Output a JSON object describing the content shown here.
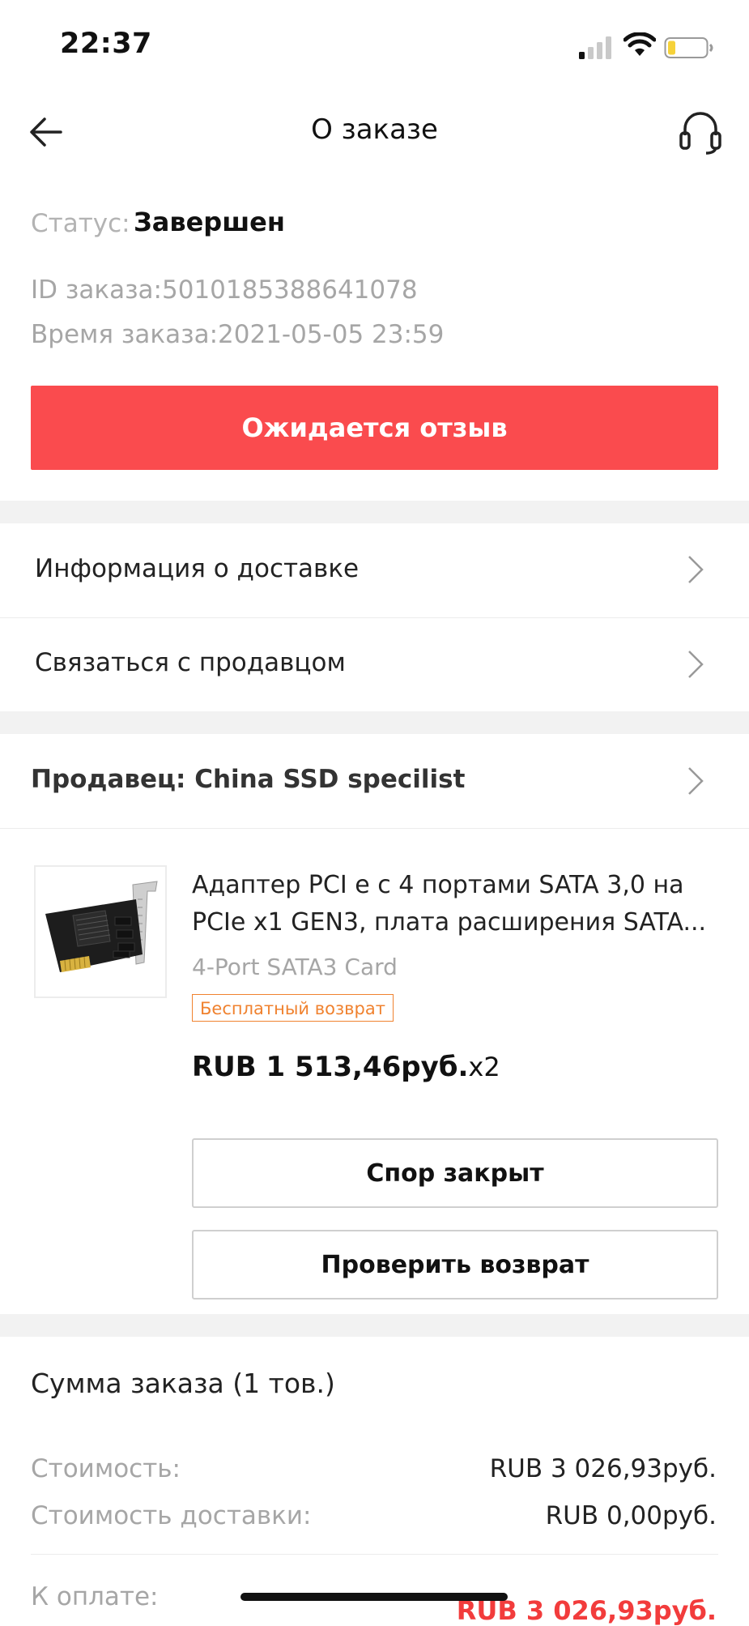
{
  "status_bar": {
    "time": "22:37"
  },
  "nav": {
    "title": "О заказе",
    "back_icon": "arrow-left-icon",
    "support_icon": "headset-icon"
  },
  "order": {
    "status_label": "Статус:",
    "status_value": "Завершен",
    "id_line": "ID заказа:5010185388641078",
    "time_line": "Время заказа:2021-05-05 23:59",
    "review_button": "Ожидается отзыв"
  },
  "links": {
    "delivery_info": "Информация о доставке",
    "contact_seller": "Связаться с продавцом"
  },
  "seller": {
    "label": "Продавец: China SSD specilist"
  },
  "product": {
    "title": "Адаптер PCI e с 4 портами SATA 3,0 на PCIe x1 GEN3, плата расширения SATA...",
    "variant": "4-Port SATA3 Card",
    "badge": "Бесплатный возврат",
    "price": "RUB 1 513,46руб.",
    "quantity": "x2",
    "dispute_button": "Спор закрыт",
    "check_return_button": "Проверить возврат"
  },
  "summary": {
    "title": "Сумма заказа (1 тов.)",
    "cost_label": "Стоимость:",
    "cost_value": "RUB 3 026,93руб.",
    "shipping_label": "Стоимость доставки:",
    "shipping_value": "RUB 0,00руб.",
    "total_label": "К оплате:",
    "total_value": "RUB 3 026,93руб."
  },
  "colors": {
    "accent_red": "#fa4b4e",
    "total_red": "#f23c3c",
    "badge_orange": "#f0822f",
    "section_gap": "#f2f2f2"
  }
}
